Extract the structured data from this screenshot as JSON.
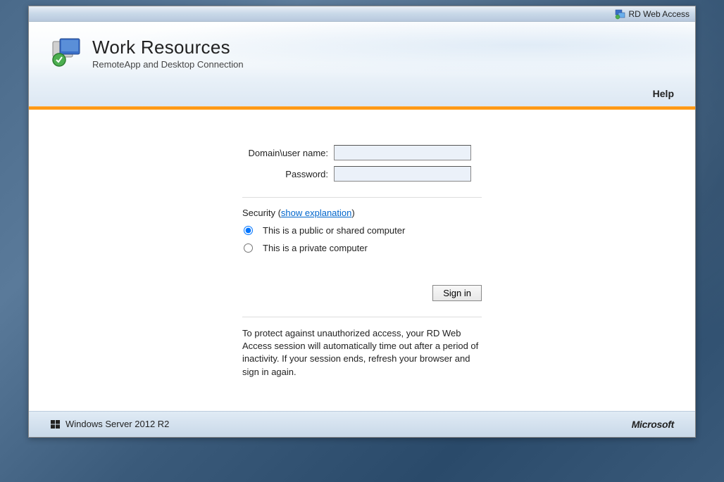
{
  "topbar": {
    "label": "RD Web Access"
  },
  "header": {
    "title": "Work Resources",
    "subtitle": "RemoteApp and Desktop Connection"
  },
  "nav": {
    "help": "Help"
  },
  "form": {
    "username_label": "Domain\\user name:",
    "password_label": "Password:",
    "username_value": "",
    "password_value": "",
    "security_prefix": "Security (",
    "security_link": "show explanation",
    "security_suffix": ")",
    "option_public": "This is a public or shared computer",
    "option_private": "This is a private computer",
    "signin_label": "Sign in",
    "notice": "To protect against unauthorized access, your RD Web Access session will automatically time out after a period of inactivity. If your session ends, refresh your browser and sign in again."
  },
  "footer": {
    "product": "Windows Server 2012 R2",
    "vendor": "Microsoft"
  }
}
